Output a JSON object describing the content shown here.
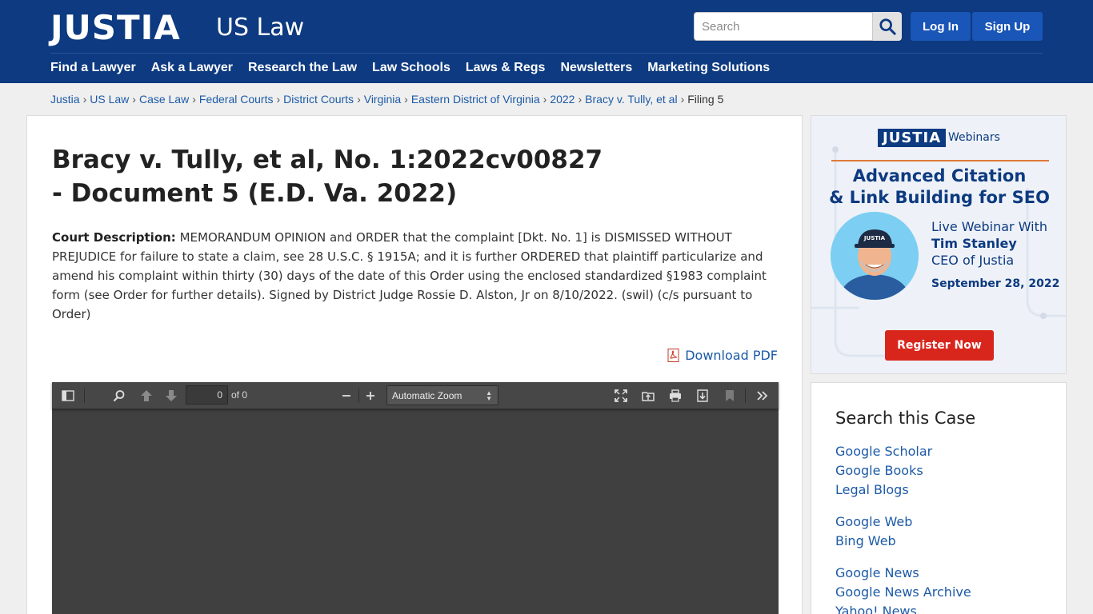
{
  "header": {
    "logo": "JUSTIA",
    "logo_sub": "US Law",
    "search_placeholder": "Search",
    "login": "Log In",
    "signup": "Sign Up",
    "nav": [
      "Find a Lawyer",
      "Ask a Lawyer",
      "Research the Law",
      "Law Schools",
      "Laws & Regs",
      "Newsletters",
      "Marketing Solutions"
    ]
  },
  "breadcrumb": {
    "links": [
      "Justia",
      "US Law",
      "Case Law",
      "Federal Courts",
      "District Courts",
      "Virginia",
      "Eastern District of Virginia",
      "2022",
      "Bracy v. Tully, et al"
    ],
    "separator": "›",
    "current": "Filing 5"
  },
  "main": {
    "title": "Bracy v. Tully, et al, No. 1:2022cv00827 - Document 5 (E.D. Va. 2022)",
    "desc_label": "Court Description:",
    "desc_text": "MEMORANDUM OPINION and ORDER that the complaint [Dkt. No. 1] is DISMISSED WITHOUT PREJUDICE for failure to state a claim, see 28 U.S.C. § 1915A; and it is further ORDERED that plaintiff particularize and amend his complaint within thirty (30) days of the date of this Order using the enclosed standardized §1983 complaint form (see Order for further details). Signed by District Judge Rossie D. Alston, Jr on 8/10/2022. (swil) (c/s pursuant to Order)",
    "download": "Download PDF"
  },
  "viewer": {
    "page_value": "0",
    "of_label": "of 0",
    "zoom": "Automatic Zoom"
  },
  "ad": {
    "logo": "JUSTIA",
    "logo_sub": "Webinars",
    "title_line1": "Advanced Citation",
    "title_line2": "& Link Building for SEO",
    "live": "Live Webinar With",
    "name": "Tim Stanley",
    "role": "CEO of Justia",
    "date": "September 28, 2022",
    "button": "Register Now",
    "cap_text": "JUSTIA"
  },
  "search_case": {
    "heading": "Search this Case",
    "group1": [
      "Google Scholar",
      "Google Books",
      "Legal Blogs"
    ],
    "group2": [
      "Google Web",
      "Bing Web"
    ],
    "group3": [
      "Google News",
      "Google News Archive",
      "Yahoo! News"
    ]
  },
  "colors": {
    "header_bg": "#0d3a80",
    "button_bg": "#1a56b8",
    "link": "#1c5aa6",
    "register_btn": "#d9261c",
    "viewer_bg": "#404040"
  }
}
